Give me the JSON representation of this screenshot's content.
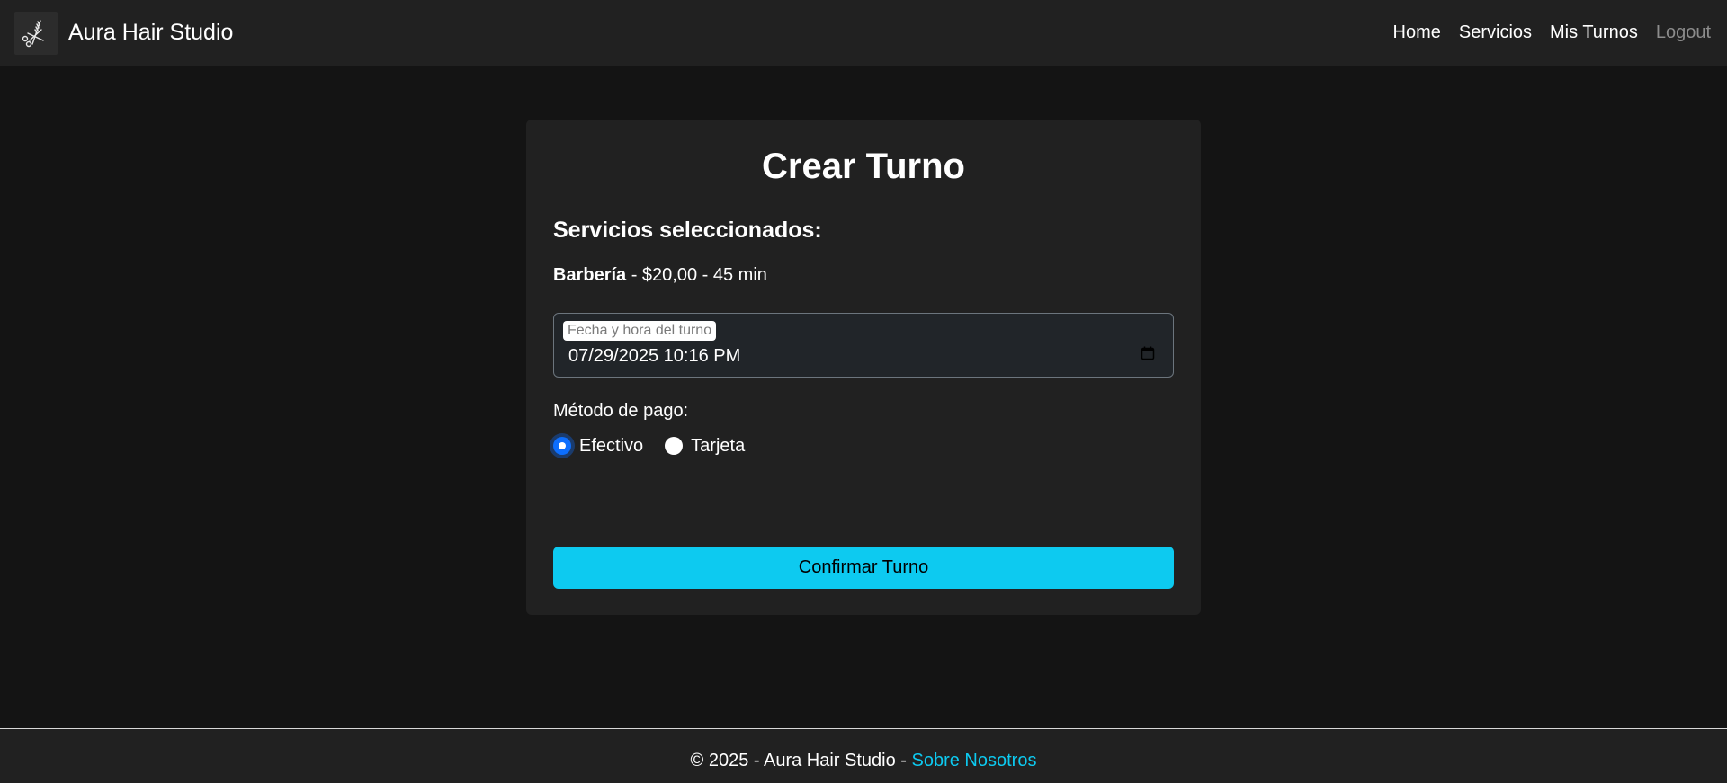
{
  "brand": {
    "name": "Aura Hair Studio",
    "logo_icon": "scissors-comb-icon"
  },
  "nav": {
    "links": [
      {
        "label": "Home"
      },
      {
        "label": "Servicios"
      },
      {
        "label": "Mis Turnos"
      },
      {
        "label": "Logout"
      }
    ]
  },
  "form": {
    "title": "Crear Turno",
    "selected_services_heading": "Servicios seleccionados:",
    "service": {
      "name": "Barbería",
      "details": " - $20,00 - 45 min"
    },
    "datetime": {
      "label": "Fecha y hora del turno",
      "value": "07/29/2025 10:16 PM",
      "icon": "calendar-icon"
    },
    "payment": {
      "label": "Método de pago:",
      "options": [
        {
          "label": "Efectivo",
          "checked": true
        },
        {
          "label": "Tarjeta",
          "checked": false
        }
      ]
    },
    "submit_label": "Confirmar Turno"
  },
  "footer": {
    "text": "© 2025 - Aura Hair Studio - ",
    "link": "Sobre Nosotros"
  },
  "colors": {
    "background": "#141414",
    "surface": "#212121",
    "accent": "#0dcaf0",
    "radio_checked": "#0d6efd",
    "muted_link": "#8c8c8c"
  }
}
